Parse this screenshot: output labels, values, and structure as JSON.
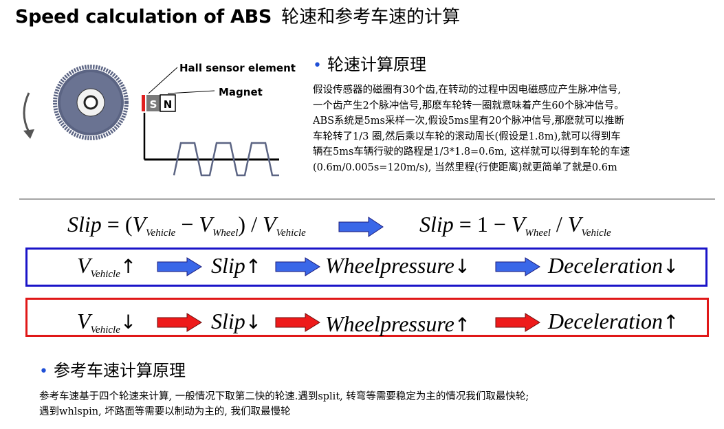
{
  "title": {
    "en": "Speed calculation of ABS",
    "zh": "轮速和参考车速的计算"
  },
  "sensor_figure": {
    "hall_label": "Hall sensor element",
    "magnet_label": "Magnet",
    "s_pole": "S",
    "n_pole": "N",
    "colors": {
      "gear": "#5b6483",
      "sensor_red": "#e02020"
    }
  },
  "wheel_speed_section": {
    "heading": "轮速计算原理",
    "paragraph": "假设传感器的磁圈有30个齿,在转动的过程中因电磁感应产生脉冲信号,\n一个齿产生2个脉冲信号,那麽车轮转一圈就意味着产生60个脉冲信号。\nABS系统是5ms采样一次,假设5ms里有20个脉冲信号,那麽就可以推断\n车轮转了1/3 圈,然后乘以车轮的滚动周长(假设是1.8m),就可以得到车\n辆在5ms车辆行驶的路程是1/3*1.8=0.6m, 这样就可以得到车轮的车速\n(0.6m/0.005s=120m/s), 当然里程(行使距离)就更简单了就是0.6m"
  },
  "formula": {
    "left": {
      "slip": "Slip",
      "eq": "= (",
      "v1": "V",
      "v1_sub": "Vehicle",
      "minus": "−",
      "v2": "V",
      "v2_sub": "Wheel",
      "close": ") / ",
      "v3": "V",
      "v3_sub": "Vehicle"
    },
    "right": {
      "slip": "Slip",
      "eq": "= 1 − ",
      "v1": "V",
      "v1_sub": "Wheel",
      "div": " / ",
      "v2": "V",
      "v2_sub": "Vehicle"
    }
  },
  "chain_blue": {
    "v": "V",
    "v_sub": "Vehicle",
    "a1": "↑",
    "slip": "Slip",
    "a2": "↑",
    "pressure": "Wheelpressure",
    "a3": "↓",
    "decel": "Deceleration",
    "a4": "↓",
    "color": "#1a14c8",
    "arrow_color": "#3a67e8"
  },
  "chain_red": {
    "v": "V",
    "v_sub": "Vehicle",
    "a1": "↓",
    "slip": "Slip",
    "a2": "↓",
    "pressure": "Wheelpressure",
    "a3": "↑",
    "decel": "Deceleration",
    "a4": "↑",
    "color": "#e01818",
    "arrow_color": "#ee1a1a"
  },
  "reference_section": {
    "heading": "参考车速计算原理",
    "paragraph": "参考车速基于四个轮速来计算, 一般情况下取第二快的轮速.遇到split, 转弯等需要稳定为主的情况我们取最快轮;\n遇到whlspin, 坏路面等需要以制动为主的, 我们取最慢轮"
  }
}
